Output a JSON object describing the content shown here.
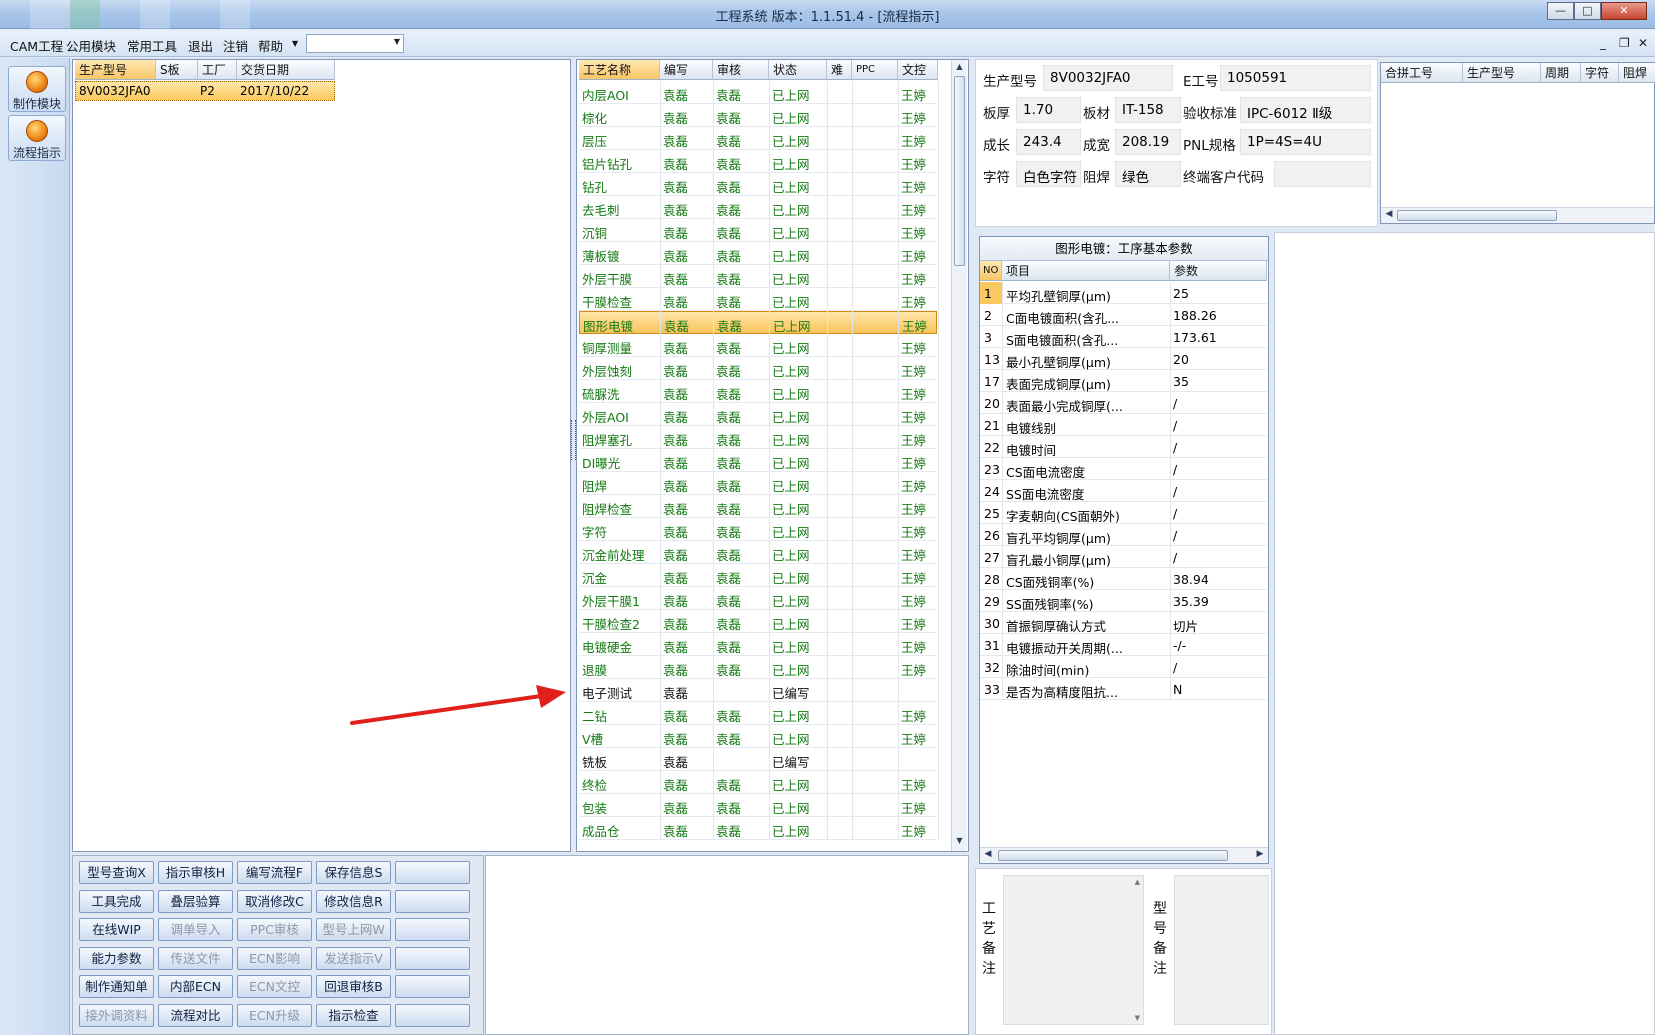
{
  "window": {
    "title": "工程系统   版本：1.1.51.4 - [流程指示]",
    "minimize": "—",
    "maximize": "□",
    "close": "✕"
  },
  "menu": {
    "items": [
      "CAM工程",
      "公用模块",
      "常用工具",
      "退出",
      "注销",
      "帮助"
    ],
    "combo_value": "",
    "mdi_min": "_",
    "mdi_restore": "❐",
    "mdi_close": "✕"
  },
  "nav": [
    {
      "label": "制作模块",
      "icon": "make-module-icon"
    },
    {
      "label": "流程指示",
      "icon": "flow-indicator-icon"
    }
  ],
  "orders": {
    "columns": [
      "生产型号",
      "S板",
      "工厂",
      "交货日期"
    ],
    "rows": [
      {
        "model": "8V0032JFA0",
        "s": "",
        "factory": "P2",
        "date": "2017/10/22"
      }
    ]
  },
  "process": {
    "columns": [
      "工艺名称",
      "编写",
      "审核",
      "状态",
      "难",
      "PPC",
      "文控"
    ],
    "rows": [
      {
        "name": "内层AOI",
        "writer": "袁磊",
        "reviewer": "袁磊",
        "status": "已上网",
        "doc": "王婷",
        "selected": false,
        "pending": false
      },
      {
        "name": "棕化",
        "writer": "袁磊",
        "reviewer": "袁磊",
        "status": "已上网",
        "doc": "王婷",
        "selected": false,
        "pending": false
      },
      {
        "name": "层压",
        "writer": "袁磊",
        "reviewer": "袁磊",
        "status": "已上网",
        "doc": "王婷",
        "selected": false,
        "pending": false
      },
      {
        "name": "铝片钻孔",
        "writer": "袁磊",
        "reviewer": "袁磊",
        "status": "已上网",
        "doc": "王婷",
        "selected": false,
        "pending": false
      },
      {
        "name": "钻孔",
        "writer": "袁磊",
        "reviewer": "袁磊",
        "status": "已上网",
        "doc": "王婷",
        "selected": false,
        "pending": false
      },
      {
        "name": "去毛刺",
        "writer": "袁磊",
        "reviewer": "袁磊",
        "status": "已上网",
        "doc": "王婷",
        "selected": false,
        "pending": false
      },
      {
        "name": "沉铜",
        "writer": "袁磊",
        "reviewer": "袁磊",
        "status": "已上网",
        "doc": "王婷",
        "selected": false,
        "pending": false
      },
      {
        "name": "薄板镀",
        "writer": "袁磊",
        "reviewer": "袁磊",
        "status": "已上网",
        "doc": "王婷",
        "selected": false,
        "pending": false
      },
      {
        "name": "外层干膜",
        "writer": "袁磊",
        "reviewer": "袁磊",
        "status": "已上网",
        "doc": "王婷",
        "selected": false,
        "pending": false
      },
      {
        "name": "干膜检查",
        "writer": "袁磊",
        "reviewer": "袁磊",
        "status": "已上网",
        "doc": "王婷",
        "selected": false,
        "pending": false
      },
      {
        "name": "图形电镀",
        "writer": "袁磊",
        "reviewer": "袁磊",
        "status": "已上网",
        "doc": "王婷",
        "selected": true,
        "pending": false
      },
      {
        "name": "铜厚测量",
        "writer": "袁磊",
        "reviewer": "袁磊",
        "status": "已上网",
        "doc": "王婷",
        "selected": false,
        "pending": false
      },
      {
        "name": "外层蚀刻",
        "writer": "袁磊",
        "reviewer": "袁磊",
        "status": "已上网",
        "doc": "王婷",
        "selected": false,
        "pending": false
      },
      {
        "name": "硫脲洗",
        "writer": "袁磊",
        "reviewer": "袁磊",
        "status": "已上网",
        "doc": "王婷",
        "selected": false,
        "pending": false
      },
      {
        "name": "外层AOI",
        "writer": "袁磊",
        "reviewer": "袁磊",
        "status": "已上网",
        "doc": "王婷",
        "selected": false,
        "pending": false
      },
      {
        "name": "阻焊塞孔",
        "writer": "袁磊",
        "reviewer": "袁磊",
        "status": "已上网",
        "doc": "王婷",
        "selected": false,
        "pending": false
      },
      {
        "name": "DI曝光",
        "writer": "袁磊",
        "reviewer": "袁磊",
        "status": "已上网",
        "doc": "王婷",
        "selected": false,
        "pending": false
      },
      {
        "name": "阻焊",
        "writer": "袁磊",
        "reviewer": "袁磊",
        "status": "已上网",
        "doc": "王婷",
        "selected": false,
        "pending": false
      },
      {
        "name": "阻焊检查",
        "writer": "袁磊",
        "reviewer": "袁磊",
        "status": "已上网",
        "doc": "王婷",
        "selected": false,
        "pending": false
      },
      {
        "name": "字符",
        "writer": "袁磊",
        "reviewer": "袁磊",
        "status": "已上网",
        "doc": "王婷",
        "selected": false,
        "pending": false
      },
      {
        "name": "沉金前处理",
        "writer": "袁磊",
        "reviewer": "袁磊",
        "status": "已上网",
        "doc": "王婷",
        "selected": false,
        "pending": false
      },
      {
        "name": "沉金",
        "writer": "袁磊",
        "reviewer": "袁磊",
        "status": "已上网",
        "doc": "王婷",
        "selected": false,
        "pending": false
      },
      {
        "name": "外层干膜1",
        "writer": "袁磊",
        "reviewer": "袁磊",
        "status": "已上网",
        "doc": "王婷",
        "selected": false,
        "pending": false
      },
      {
        "name": "干膜检查2",
        "writer": "袁磊",
        "reviewer": "袁磊",
        "status": "已上网",
        "doc": "王婷",
        "selected": false,
        "pending": false
      },
      {
        "name": "电镀硬金",
        "writer": "袁磊",
        "reviewer": "袁磊",
        "status": "已上网",
        "doc": "王婷",
        "selected": false,
        "pending": false
      },
      {
        "name": "退膜",
        "writer": "袁磊",
        "reviewer": "袁磊",
        "status": "已上网",
        "doc": "王婷",
        "selected": false,
        "pending": false
      },
      {
        "name": "电子测试",
        "writer": "袁磊",
        "reviewer": "",
        "status": "已编写",
        "doc": "",
        "selected": false,
        "pending": true
      },
      {
        "name": "二钻",
        "writer": "袁磊",
        "reviewer": "袁磊",
        "status": "已上网",
        "doc": "王婷",
        "selected": false,
        "pending": false
      },
      {
        "name": "V槽",
        "writer": "袁磊",
        "reviewer": "袁磊",
        "status": "已上网",
        "doc": "王婷",
        "selected": false,
        "pending": false
      },
      {
        "name": "铣板",
        "writer": "袁磊",
        "reviewer": "",
        "status": "已编写",
        "doc": "",
        "selected": false,
        "pending": true
      },
      {
        "name": "终检",
        "writer": "袁磊",
        "reviewer": "袁磊",
        "status": "已上网",
        "doc": "王婷",
        "selected": false,
        "pending": false
      },
      {
        "name": "包装",
        "writer": "袁磊",
        "reviewer": "袁磊",
        "status": "已上网",
        "doc": "王婷",
        "selected": false,
        "pending": false
      },
      {
        "name": "成品仓",
        "writer": "袁磊",
        "reviewer": "袁磊",
        "status": "已上网",
        "doc": "王婷",
        "selected": false,
        "pending": false
      }
    ]
  },
  "info": {
    "model_label": "生产型号",
    "model": "8V0032JFA0",
    "eno_label": "E工号",
    "eno": "1050591",
    "thickness_label": "板厚",
    "thickness": "1.70",
    "material_label": "板材",
    "material": "IT-158",
    "standard_label": "验收标准",
    "standard": "IPC-6012 Ⅱ级",
    "length_label": "成长",
    "length": "243.4",
    "width_label": "成宽",
    "width": "208.19",
    "pnl_label": "PNL规格",
    "pnl": "1P=4S=4U",
    "char_label": "字符",
    "char": "白色字符",
    "mask_label": "阻焊",
    "mask": "绿色",
    "customer_label": "终端客户代码",
    "customer": ""
  },
  "combine": {
    "columns": [
      "合拼工号",
      "生产型号",
      "周期",
      "字符",
      "阻焊"
    ]
  },
  "params": {
    "title": "图形电镀：工序基本参数",
    "columns": [
      "NO",
      "项目",
      "参数"
    ],
    "rows": [
      {
        "no": "1",
        "item": "平均孔壁铜厚(μm)",
        "value": "25"
      },
      {
        "no": "2",
        "item": "C面电镀面积(含孔...",
        "value": "188.26"
      },
      {
        "no": "3",
        "item": "S面电镀面积(含孔...",
        "value": "173.61"
      },
      {
        "no": "13",
        "item": "最小孔壁铜厚(μm)",
        "value": "20"
      },
      {
        "no": "17",
        "item": "表面完成铜厚(μm)",
        "value": "35"
      },
      {
        "no": "20",
        "item": "表面最小完成铜厚(...",
        "value": "/"
      },
      {
        "no": "21",
        "item": "电镀线别",
        "value": "/"
      },
      {
        "no": "22",
        "item": "电镀时间",
        "value": "/"
      },
      {
        "no": "23",
        "item": "CS面电流密度",
        "value": "/"
      },
      {
        "no": "24",
        "item": "SS面电流密度",
        "value": "/"
      },
      {
        "no": "25",
        "item": "字麦朝向(CS面朝外)",
        "value": "/"
      },
      {
        "no": "26",
        "item": "盲孔平均铜厚(μm)",
        "value": "/"
      },
      {
        "no": "27",
        "item": "盲孔最小铜厚(μm)",
        "value": "/"
      },
      {
        "no": "28",
        "item": "CS面残铜率(%)",
        "value": "38.94"
      },
      {
        "no": "29",
        "item": "SS面残铜率(%)",
        "value": "35.39"
      },
      {
        "no": "30",
        "item": "首振铜厚确认方式",
        "value": "切片"
      },
      {
        "no": "31",
        "item": "电镀振动开关周期(...",
        "value": "-/-"
      },
      {
        "no": "32",
        "item": "除油时间(min)",
        "value": "/"
      },
      {
        "no": "33",
        "item": "是否为高精度阻抗...",
        "value": "N"
      }
    ]
  },
  "remarks": {
    "process_label": "工艺备注",
    "model_label": "型号备注"
  },
  "buttons": [
    {
      "label": "型号查询X",
      "enabled": true
    },
    {
      "label": "指示审核H",
      "enabled": true
    },
    {
      "label": "编写流程F",
      "enabled": true
    },
    {
      "label": "保存信息S",
      "enabled": true
    },
    {
      "label": "",
      "enabled": true
    },
    {
      "label": "工具完成",
      "enabled": true
    },
    {
      "label": "叠层验算",
      "enabled": true
    },
    {
      "label": "取消修改C",
      "enabled": true
    },
    {
      "label": "修改信息R",
      "enabled": true
    },
    {
      "label": "",
      "enabled": true
    },
    {
      "label": "在线WIP",
      "enabled": true
    },
    {
      "label": "调单导入",
      "enabled": false
    },
    {
      "label": "PPC审核",
      "enabled": false
    },
    {
      "label": "型号上网W",
      "enabled": false
    },
    {
      "label": "",
      "enabled": true
    },
    {
      "label": "能力参数",
      "enabled": true
    },
    {
      "label": "传送文件",
      "enabled": false
    },
    {
      "label": "ECN影响",
      "enabled": false
    },
    {
      "label": "发送指示V",
      "enabled": false
    },
    {
      "label": "",
      "enabled": true
    },
    {
      "label": "制作通知单",
      "enabled": true
    },
    {
      "label": "内部ECN",
      "enabled": true
    },
    {
      "label": "ECN文控",
      "enabled": false
    },
    {
      "label": "回退审核B",
      "enabled": true
    },
    {
      "label": "",
      "enabled": true
    },
    {
      "label": "接外调资料",
      "enabled": false
    },
    {
      "label": "流程对比",
      "enabled": true
    },
    {
      "label": "ECN升级",
      "enabled": false
    },
    {
      "label": "指示检查",
      "enabled": true
    },
    {
      "label": "",
      "enabled": true
    }
  ],
  "colors": {
    "accent_row": "#f8c45a",
    "ok_text": "#147a14",
    "arrow": "#e0201d"
  }
}
